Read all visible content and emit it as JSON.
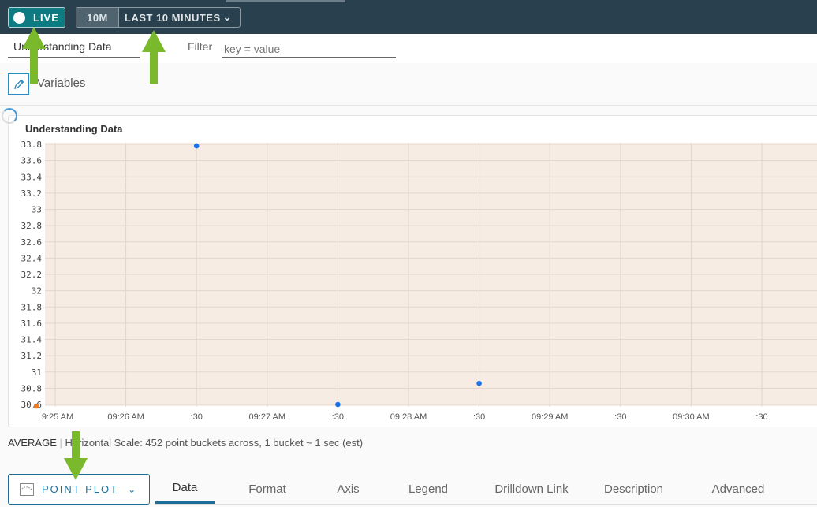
{
  "toolbar": {
    "live_label": "LIVE",
    "range_short": "10M",
    "range_label": "LAST 10 MINUTES"
  },
  "dashboard": {
    "name": "Understanding Data",
    "filter_label": "Filter",
    "filter_placeholder": "key = value",
    "variables_label": "Variables"
  },
  "chart_data": {
    "type": "scatter",
    "title": "Understanding Data",
    "ylim": [
      30.6,
      33.8
    ],
    "y_ticks": [
      "33.8",
      "33.6",
      "33.4",
      "33.2",
      "33",
      "32.8",
      "32.6",
      "32.4",
      "32.2",
      "32",
      "31.8",
      "31.6",
      "31.4",
      "31.2",
      "31",
      "30.8",
      "30.6"
    ],
    "x_ticks": [
      "9:25 AM",
      "09:26 AM",
      ":30",
      "09:27 AM",
      ":30",
      "09:28 AM",
      ":30",
      "09:29 AM",
      ":30",
      "09:30 AM",
      ":30"
    ],
    "grid": true,
    "background": "#f6ece4",
    "series": [
      {
        "color": "#1a73e8",
        "points": [
          {
            "x": "09:26:00",
            "y": 33.78
          },
          {
            "x": "09:27:00",
            "y": 30.6
          },
          {
            "x": "09:28:00",
            "y": 30.86
          }
        ]
      },
      {
        "color": "#f07b1e",
        "points": [
          {
            "x": "09:24:52",
            "y": 30.58
          }
        ]
      }
    ]
  },
  "footer": {
    "aggregation": "AVERAGE",
    "scale_text": "Horizontal Scale: 452 point buckets across, 1 bucket ~ 1 sec (est)"
  },
  "editor": {
    "chart_type": "POINT PLOT",
    "tabs": [
      "Data",
      "Format",
      "Axis",
      "Legend",
      "Drilldown Link",
      "Description",
      "Advanced"
    ],
    "active_tab": "Data"
  },
  "colors": {
    "accent": "#1a6e98",
    "topbar": "#29414e",
    "live": "#0e7b83",
    "annotation_arrow": "#7ab92b"
  }
}
